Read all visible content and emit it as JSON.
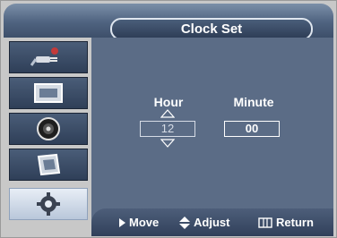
{
  "title": "Clock Set",
  "sidebar": {
    "items": [
      {
        "icon": "plug-icon"
      },
      {
        "icon": "picture-icon"
      },
      {
        "icon": "speaker-icon"
      },
      {
        "icon": "channel-icon"
      },
      {
        "icon": "gear-icon",
        "active": true
      }
    ]
  },
  "clock": {
    "hour_label": "Hour",
    "minute_label": "Minute",
    "hour_value": "12",
    "minute_value": "00"
  },
  "footer": {
    "move": "Move",
    "adjust": "Adjust",
    "return": "Return"
  },
  "colors": {
    "panel": "#5b6c86",
    "frame": "#c8c8c8",
    "text": "#ffffff"
  }
}
